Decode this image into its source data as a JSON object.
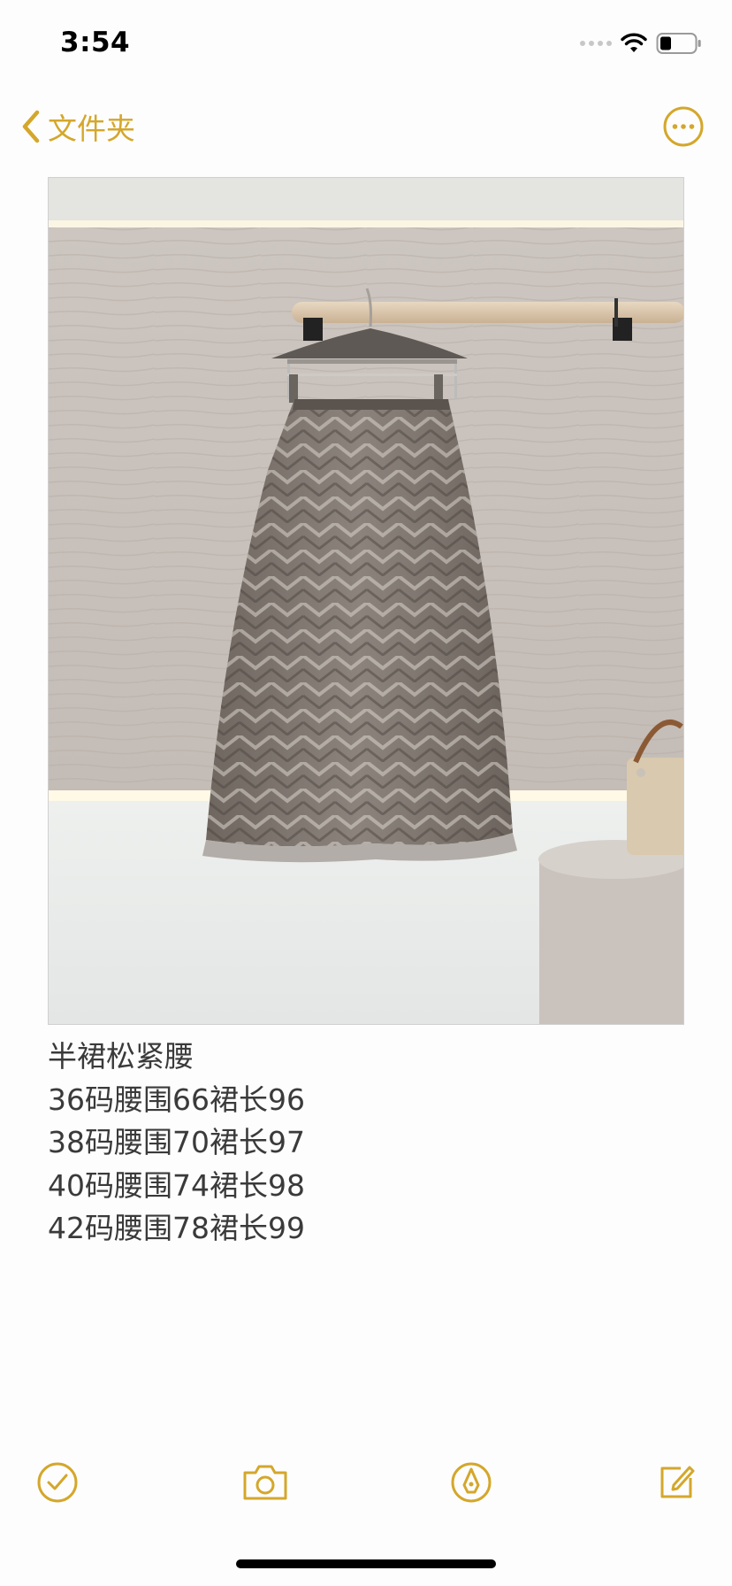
{
  "status_bar": {
    "time": "3:54"
  },
  "nav": {
    "back_label": "文件夹"
  },
  "note": {
    "lines": [
      "半裙松紧腰",
      "36码腰围66裙长96",
      "38码腰围70裙长97",
      "40码腰围74裙长98",
      "42码腰围78裙长99"
    ]
  },
  "colors": {
    "accent": "#d4a72c",
    "text": "#3a3a3a"
  },
  "icons": {
    "back": "chevron-left-icon",
    "more": "ellipsis-circle-icon",
    "checklist": "checkmark-circle-icon",
    "camera": "camera-icon",
    "markup": "pen-tip-circle-icon",
    "compose": "compose-icon"
  }
}
